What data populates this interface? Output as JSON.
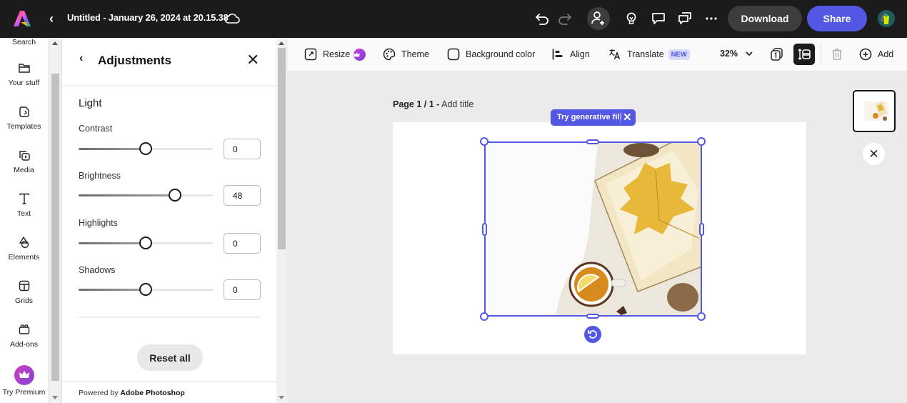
{
  "topbar": {
    "doc_title": "Untitled - January 26, 2024 at 20.15.38",
    "download_label": "Download",
    "share_label": "Share",
    "icons": [
      "adobe-express-logo",
      "back-chevron",
      "cloud-sync",
      "undo",
      "redo",
      "invite-collaborator",
      "lightbulb",
      "comment",
      "comments",
      "more"
    ]
  },
  "left_rail": {
    "items": [
      {
        "label": "Search",
        "icon": "search"
      },
      {
        "label": "Your stuff",
        "icon": "folder"
      },
      {
        "label": "Templates",
        "icon": "templates"
      },
      {
        "label": "Media",
        "icon": "media"
      },
      {
        "label": "Text",
        "icon": "text"
      },
      {
        "label": "Elements",
        "icon": "shapes"
      },
      {
        "label": "Grids",
        "icon": "grid"
      },
      {
        "label": "Add-ons",
        "icon": "addons"
      },
      {
        "label": "Try Premium",
        "icon": "crown"
      }
    ]
  },
  "adjustments_panel": {
    "title": "Adjustments",
    "section": "Light",
    "controls": [
      {
        "label": "Contrast",
        "value": "0",
        "slider_percent": 50
      },
      {
        "label": "Brightness",
        "value": "48",
        "slider_percent": 72
      },
      {
        "label": "Highlights",
        "value": "0",
        "slider_percent": 50
      },
      {
        "label": "Shadows",
        "value": "0",
        "slider_percent": 50
      }
    ],
    "reset_label": "Reset all",
    "powered_by_prefix": "Powered by",
    "powered_by_brand": "Adobe Photoshop"
  },
  "toolbar": {
    "resize": "Resize",
    "theme": "Theme",
    "background_color": "Background color",
    "align": "Align",
    "translate": "Translate",
    "new_badge": "NEW",
    "zoom": "32%",
    "add": "Add"
  },
  "canvas": {
    "page_label_bold": "Page 1 / 1 -",
    "page_label_action": "Add title",
    "generative_fill_label": "Try generative fill"
  },
  "colors": {
    "accent": "#5258e4",
    "topbar_bg": "#1b1b1b",
    "premium_gradient_start": "#c43fd8",
    "premium_gradient_end": "#8440d8"
  }
}
